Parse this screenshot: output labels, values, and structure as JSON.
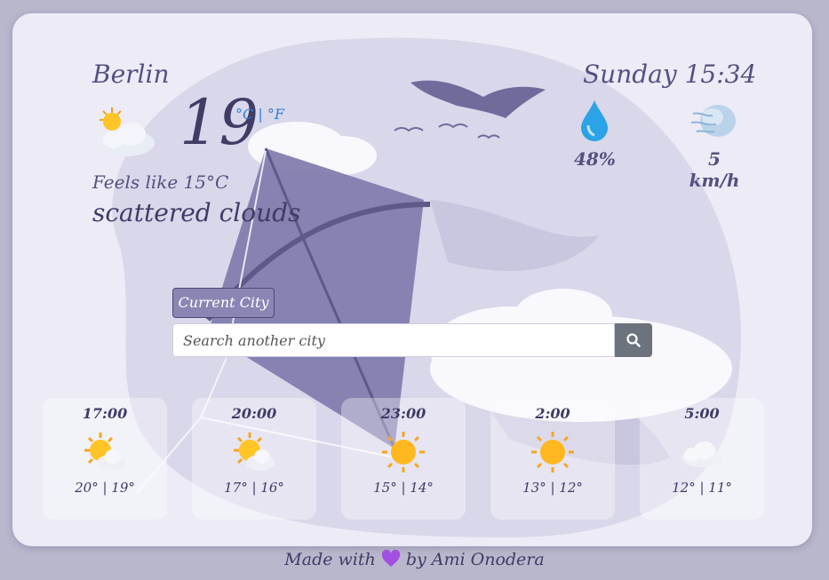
{
  "location": {
    "city": "Berlin",
    "temperature": "19",
    "unit_celsius": "°C",
    "unit_separator": "|",
    "unit_fahrenheit": "°F",
    "feels_like": "Feels like 15°C",
    "description": "scattered clouds",
    "icon": "sun-behind-cloud-icon"
  },
  "datetime": "Sunday 15:34",
  "humidity": {
    "value": "48%",
    "icon": "water-drop-icon"
  },
  "wind": {
    "value": "5 km/h",
    "icon": "wind-icon"
  },
  "search": {
    "current_city_label": "Current City",
    "placeholder": "Search another city",
    "search_icon": "search-icon"
  },
  "forecast": [
    {
      "time": "17:00",
      "temp": "20° | 19°",
      "icon": "sun-behind-cloud-icon"
    },
    {
      "time": "20:00",
      "temp": "17° | 16°",
      "icon": "sun-behind-cloud-icon"
    },
    {
      "time": "23:00",
      "temp": "15° | 14°",
      "icon": "sun-icon"
    },
    {
      "time": "2:00",
      "temp": "13° | 12°",
      "icon": "sun-icon"
    },
    {
      "time": "5:00",
      "temp": "12° | 11°",
      "icon": "cloud-icon"
    }
  ],
  "footer": {
    "prefix": "Made with",
    "heart_icon": "purple-heart-icon",
    "by": "by",
    "author": "Ami Onodera"
  },
  "colors": {
    "accent": "#8a86b4",
    "text_dark": "#3f3c66",
    "unit_link": "#2f7fd4",
    "background": "#b9b7cc"
  }
}
